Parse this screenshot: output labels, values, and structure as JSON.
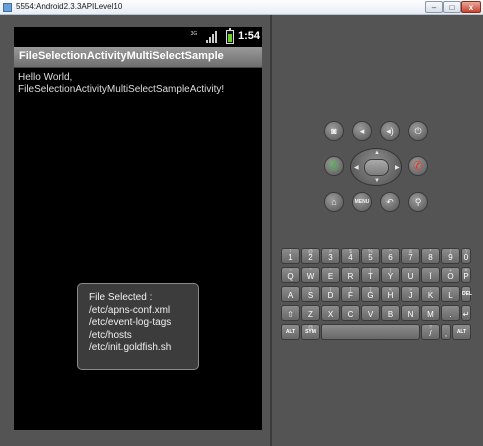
{
  "window": {
    "title": "5554:Android2.3.3APILevel10",
    "minimize": "–",
    "maximize": "□",
    "close": "x"
  },
  "statusbar": {
    "network": "3G",
    "time": "1:54"
  },
  "app": {
    "title": "FileSelectionActivityMultiSelectSample",
    "hello_line1": "Hello World,",
    "hello_line2": "FileSelectionActivityMultiSelectSampleActivity!"
  },
  "toast": {
    "header": "File Selected :",
    "files": [
      "/etc/apns-conf.xml",
      "/etc/event-log-tags",
      "/etc/hosts",
      "/etc/init.goldfish.sh"
    ]
  },
  "hardware": {
    "camera": "◙",
    "vol_down": "◂",
    "vol_up": "◂)",
    "power": "⏻",
    "call": "✆",
    "end": "✆",
    "home": "⌂",
    "menu": "MENU",
    "back": "↶",
    "search": "⚲",
    "dpad_up": "▲",
    "dpad_down": "▼",
    "dpad_left": "◀",
    "dpad_right": "▶"
  },
  "keyboard": {
    "row1": [
      {
        "k": "1",
        "s": "!"
      },
      {
        "k": "2",
        "s": "@"
      },
      {
        "k": "3",
        "s": "#"
      },
      {
        "k": "4",
        "s": "$"
      },
      {
        "k": "5",
        "s": "%"
      },
      {
        "k": "6",
        "s": "^"
      },
      {
        "k": "7",
        "s": "&"
      },
      {
        "k": "8",
        "s": "*"
      },
      {
        "k": "9",
        "s": "("
      },
      {
        "k": "0",
        "s": ")"
      }
    ],
    "row2": [
      {
        "k": "Q",
        "s": "~"
      },
      {
        "k": "W",
        "s": "\""
      },
      {
        "k": "E",
        "s": "'"
      },
      {
        "k": "R",
        "s": "`"
      },
      {
        "k": "T",
        "s": "{"
      },
      {
        "k": "Y",
        "s": "}"
      },
      {
        "k": "U",
        "s": "-"
      },
      {
        "k": "I",
        "s": "_"
      },
      {
        "k": "O",
        "s": "+"
      },
      {
        "k": "P",
        "s": "="
      }
    ],
    "row3": [
      {
        "k": "A",
        "s": ""
      },
      {
        "k": "S",
        "s": "\\"
      },
      {
        "k": "D",
        "s": "|"
      },
      {
        "k": "F",
        "s": "["
      },
      {
        "k": "G",
        "s": "]"
      },
      {
        "k": "H",
        "s": "<"
      },
      {
        "k": "J",
        "s": ">"
      },
      {
        "k": "K",
        "s": ";"
      },
      {
        "k": "L",
        "s": ":"
      },
      {
        "k": "DEL",
        "s": ""
      }
    ],
    "row4": [
      {
        "k": "⇧",
        "s": ""
      },
      {
        "k": "Z",
        "s": ""
      },
      {
        "k": "X",
        "s": ""
      },
      {
        "k": "C",
        "s": ""
      },
      {
        "k": "V",
        "s": ""
      },
      {
        "k": "B",
        "s": ""
      },
      {
        "k": "N",
        "s": ""
      },
      {
        "k": "M",
        "s": ""
      },
      {
        "k": ".",
        "s": ""
      },
      {
        "k": "↵",
        "s": ""
      }
    ],
    "row5": [
      {
        "k": "ALT",
        "s": ""
      },
      {
        "k": "SYM",
        "s": "@"
      },
      {
        "k": "",
        "s": ""
      },
      {
        "k": "/",
        "s": "?"
      },
      {
        "k": ",",
        "s": ""
      },
      {
        "k": "ALT",
        "s": ""
      }
    ]
  }
}
